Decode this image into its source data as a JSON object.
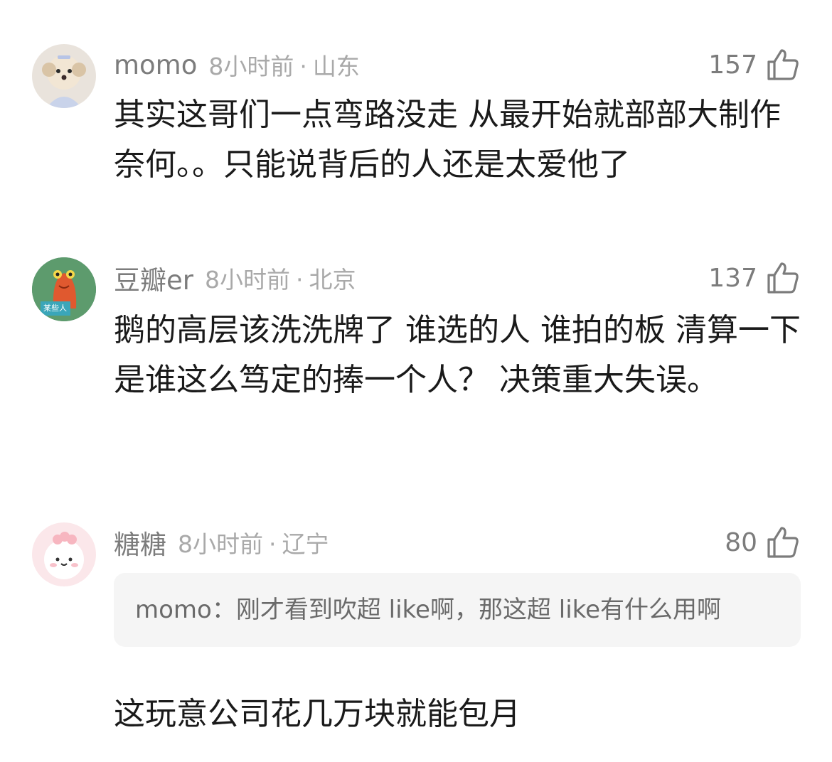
{
  "comments": [
    {
      "username": "momo",
      "time": "8小时前",
      "dot": "·",
      "location": "山东",
      "likes": "157",
      "text": "其实这哥们一点弯路没走 从最开始就部部大制作 奈何。。只能说背后的人还是太爱他了"
    },
    {
      "username": "豆瓣er",
      "time": "8小时前",
      "dot": "·",
      "location": "北京",
      "likes": "137",
      "avatar_sign": "某些人",
      "text": "鹅的高层该洗洗牌了 谁选的人 谁拍的板 清算一下 是谁这么笃定的捧一个人？ 决策重大失误。"
    },
    {
      "username": "糖糖",
      "time": "8小时前",
      "dot": "·",
      "location": "辽宁",
      "likes": "80",
      "quote_author": "momo：",
      "quote_text": "刚才看到吹超 like啊，那这超 like有什么用啊",
      "text": "这玩意公司花几万块就能包月"
    }
  ],
  "icons": {
    "like": "thumbs-up-icon"
  }
}
